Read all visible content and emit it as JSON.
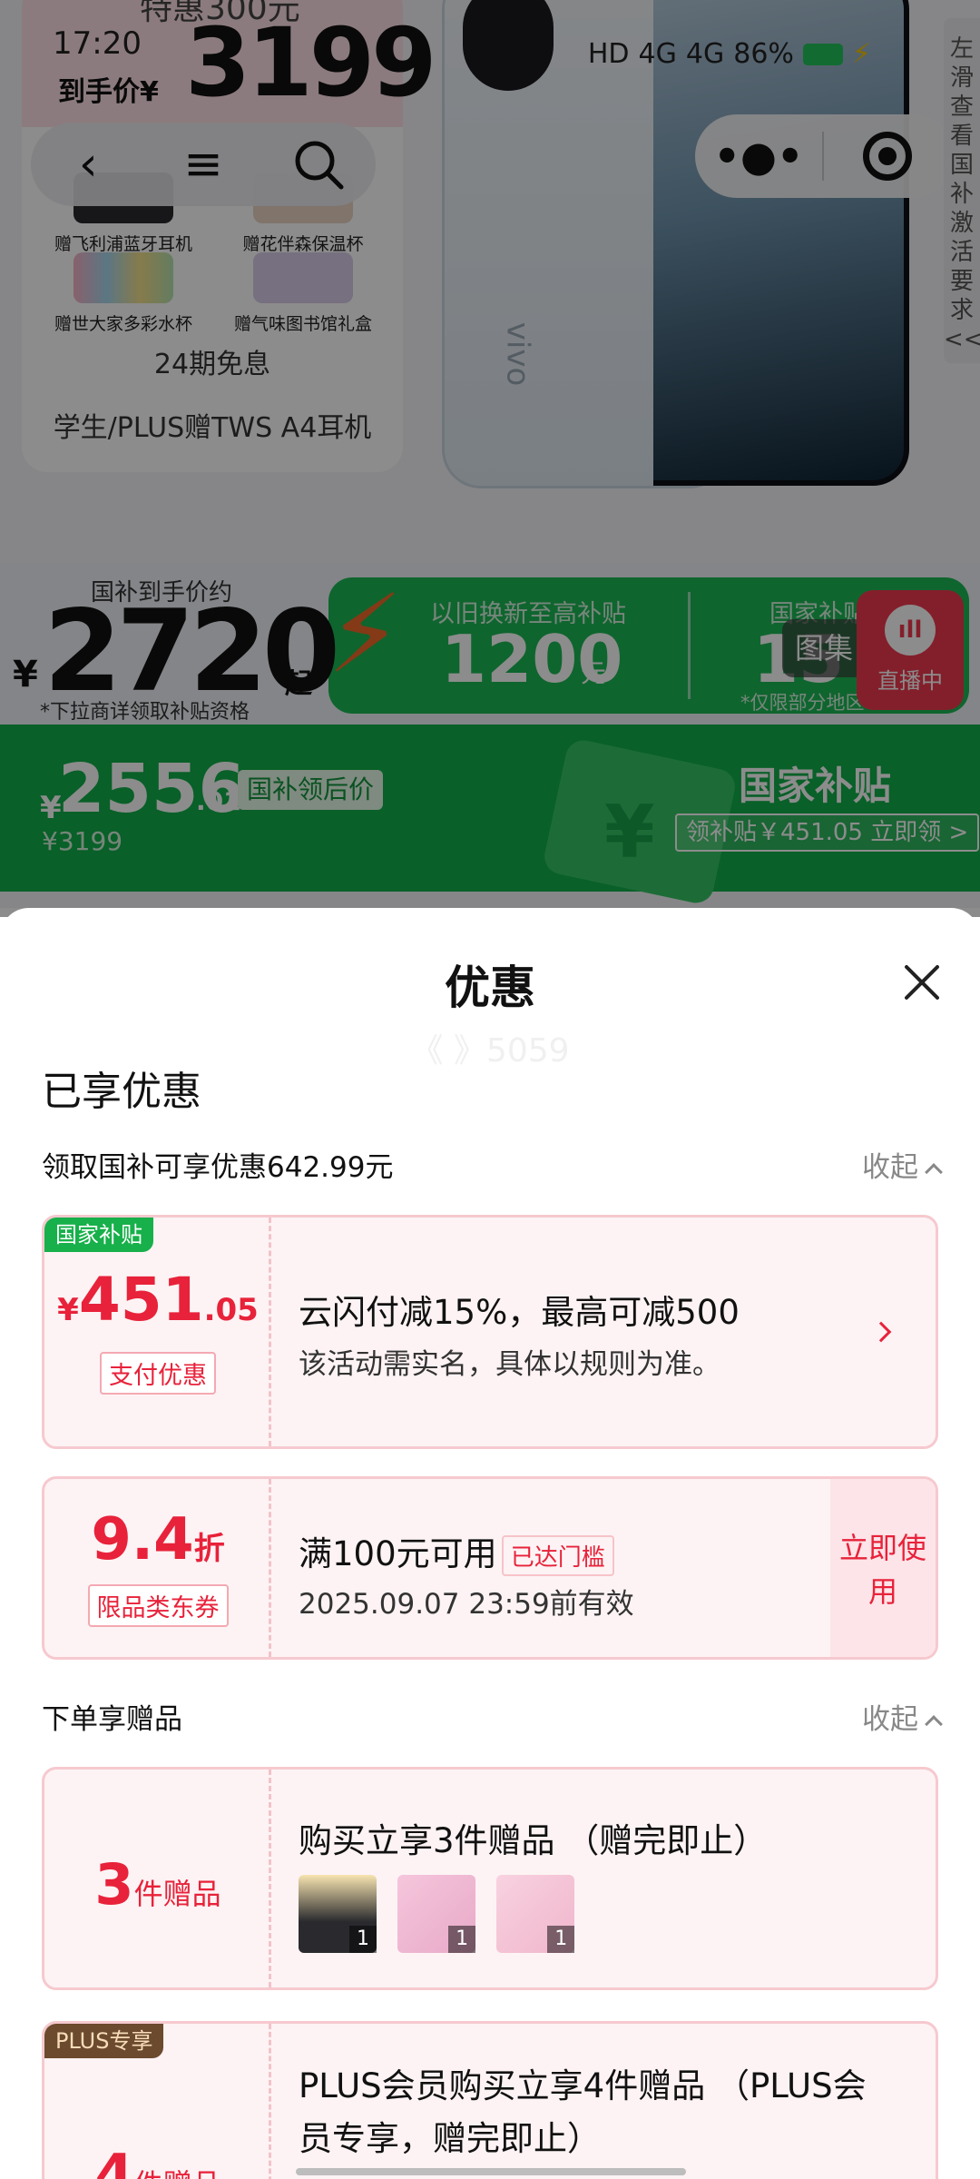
{
  "background": {
    "promo": {
      "special_text": "特惠300元",
      "time": "17:20",
      "price_label": "到手价¥",
      "price": "3199",
      "gifts": [
        {
          "label": "赠飞利浦蓝牙耳机"
        },
        {
          "label": "赠花伴森保温杯"
        },
        {
          "label": "赠世大家多彩水杯"
        },
        {
          "label": "赠气味图书馆礼盒"
        }
      ],
      "installment": "24期免息",
      "plus_line": "学生/PLUS赠TWS A4耳机"
    },
    "product_brand": "vivo",
    "status_bar": {
      "hd": "HD",
      "signal_1": "4G",
      "signal_2": "4G",
      "battery_percent": "86%"
    },
    "side_tab": "左滑查看国补激活要求<<",
    "banner": {
      "label": "国补到手价约",
      "yen": "¥",
      "price": "2720",
      "suffix": "起",
      "note": "*下拉商详领取补贴资格",
      "tradein_label": "以旧换新至高补贴",
      "tradein_amount": "1200",
      "tradein_unit": "元",
      "national_label": "国家补贴",
      "national_amount": "15",
      "national_note": "*仅限部分地区"
    },
    "gallery_label": "图集",
    "live_label": "直播中",
    "subsidy_strip": {
      "yen": "¥",
      "price": "2556",
      "cents": ".01",
      "tag": "国补领后价",
      "original_price": "¥3199",
      "title": "国家补贴",
      "claim": "领补贴￥451.05 立即领 >"
    }
  },
  "sheet": {
    "title": "优惠",
    "watermark": "《 》5059",
    "enjoyed_title": "已享优惠",
    "national_row": {
      "text": "领取国补可享优惠642.99元",
      "collapse": "收起"
    },
    "coupon_subsidy": {
      "corner_tag": "国家补贴",
      "yen": "¥",
      "amount": "451",
      "cents": ".05",
      "type": "支付优惠",
      "title": "云闪付减15%，最高可减500",
      "desc": "该活动需实名，具体以规则为准。"
    },
    "coupon_discount": {
      "amount": "9.4",
      "unit": "折",
      "type": "限品类东券",
      "title": "满100元可用",
      "threshold_tag": "已达门槛",
      "validity": "2025.09.07 23:59前有效",
      "use_button": "立即使用"
    },
    "gift_row": {
      "text": "下单享赠品",
      "collapse": "收起"
    },
    "gift_card": {
      "count": "3",
      "count_unit": "件赠品",
      "title": "购买立享3件赠品 （赠完即止）",
      "items": [
        {
          "qty": "1"
        },
        {
          "qty": "1"
        },
        {
          "qty": "1"
        }
      ]
    },
    "plus_card": {
      "corner_tag": "PLUS专享",
      "count": "4",
      "count_unit": "件赠品",
      "title": "PLUS会员购买立享4件赠品 （PLUS会员专享，赠完即止）"
    }
  },
  "colors": {
    "accent_red": "#e8223a",
    "subsidy_green": "#12b04a",
    "card_bg": "#fdf3f4",
    "plus_tag": "#6b4a2e"
  }
}
